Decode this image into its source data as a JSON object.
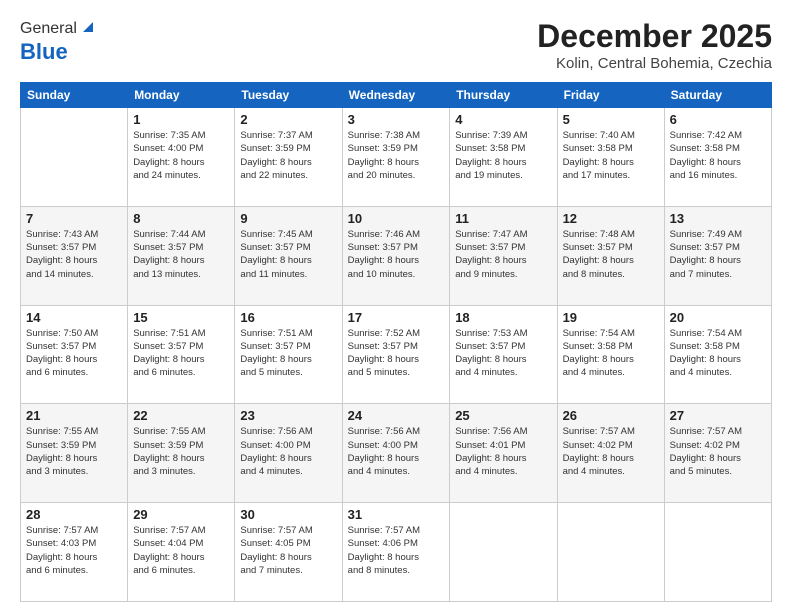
{
  "logo": {
    "general": "General",
    "blue": "Blue"
  },
  "header": {
    "month": "December 2025",
    "location": "Kolin, Central Bohemia, Czechia"
  },
  "weekdays": [
    "Sunday",
    "Monday",
    "Tuesday",
    "Wednesday",
    "Thursday",
    "Friday",
    "Saturday"
  ],
  "weeks": [
    [
      {
        "day": "",
        "info": ""
      },
      {
        "day": "1",
        "info": "Sunrise: 7:35 AM\nSunset: 4:00 PM\nDaylight: 8 hours\nand 24 minutes."
      },
      {
        "day": "2",
        "info": "Sunrise: 7:37 AM\nSunset: 3:59 PM\nDaylight: 8 hours\nand 22 minutes."
      },
      {
        "day": "3",
        "info": "Sunrise: 7:38 AM\nSunset: 3:59 PM\nDaylight: 8 hours\nand 20 minutes."
      },
      {
        "day": "4",
        "info": "Sunrise: 7:39 AM\nSunset: 3:58 PM\nDaylight: 8 hours\nand 19 minutes."
      },
      {
        "day": "5",
        "info": "Sunrise: 7:40 AM\nSunset: 3:58 PM\nDaylight: 8 hours\nand 17 minutes."
      },
      {
        "day": "6",
        "info": "Sunrise: 7:42 AM\nSunset: 3:58 PM\nDaylight: 8 hours\nand 16 minutes."
      }
    ],
    [
      {
        "day": "7",
        "info": "Sunrise: 7:43 AM\nSunset: 3:57 PM\nDaylight: 8 hours\nand 14 minutes."
      },
      {
        "day": "8",
        "info": "Sunrise: 7:44 AM\nSunset: 3:57 PM\nDaylight: 8 hours\nand 13 minutes."
      },
      {
        "day": "9",
        "info": "Sunrise: 7:45 AM\nSunset: 3:57 PM\nDaylight: 8 hours\nand 11 minutes."
      },
      {
        "day": "10",
        "info": "Sunrise: 7:46 AM\nSunset: 3:57 PM\nDaylight: 8 hours\nand 10 minutes."
      },
      {
        "day": "11",
        "info": "Sunrise: 7:47 AM\nSunset: 3:57 PM\nDaylight: 8 hours\nand 9 minutes."
      },
      {
        "day": "12",
        "info": "Sunrise: 7:48 AM\nSunset: 3:57 PM\nDaylight: 8 hours\nand 8 minutes."
      },
      {
        "day": "13",
        "info": "Sunrise: 7:49 AM\nSunset: 3:57 PM\nDaylight: 8 hours\nand 7 minutes."
      }
    ],
    [
      {
        "day": "14",
        "info": "Sunrise: 7:50 AM\nSunset: 3:57 PM\nDaylight: 8 hours\nand 6 minutes."
      },
      {
        "day": "15",
        "info": "Sunrise: 7:51 AM\nSunset: 3:57 PM\nDaylight: 8 hours\nand 6 minutes."
      },
      {
        "day": "16",
        "info": "Sunrise: 7:51 AM\nSunset: 3:57 PM\nDaylight: 8 hours\nand 5 minutes."
      },
      {
        "day": "17",
        "info": "Sunrise: 7:52 AM\nSunset: 3:57 PM\nDaylight: 8 hours\nand 5 minutes."
      },
      {
        "day": "18",
        "info": "Sunrise: 7:53 AM\nSunset: 3:57 PM\nDaylight: 8 hours\nand 4 minutes."
      },
      {
        "day": "19",
        "info": "Sunrise: 7:54 AM\nSunset: 3:58 PM\nDaylight: 8 hours\nand 4 minutes."
      },
      {
        "day": "20",
        "info": "Sunrise: 7:54 AM\nSunset: 3:58 PM\nDaylight: 8 hours\nand 4 minutes."
      }
    ],
    [
      {
        "day": "21",
        "info": "Sunrise: 7:55 AM\nSunset: 3:59 PM\nDaylight: 8 hours\nand 3 minutes."
      },
      {
        "day": "22",
        "info": "Sunrise: 7:55 AM\nSunset: 3:59 PM\nDaylight: 8 hours\nand 3 minutes."
      },
      {
        "day": "23",
        "info": "Sunrise: 7:56 AM\nSunset: 4:00 PM\nDaylight: 8 hours\nand 4 minutes."
      },
      {
        "day": "24",
        "info": "Sunrise: 7:56 AM\nSunset: 4:00 PM\nDaylight: 8 hours\nand 4 minutes."
      },
      {
        "day": "25",
        "info": "Sunrise: 7:56 AM\nSunset: 4:01 PM\nDaylight: 8 hours\nand 4 minutes."
      },
      {
        "day": "26",
        "info": "Sunrise: 7:57 AM\nSunset: 4:02 PM\nDaylight: 8 hours\nand 4 minutes."
      },
      {
        "day": "27",
        "info": "Sunrise: 7:57 AM\nSunset: 4:02 PM\nDaylight: 8 hours\nand 5 minutes."
      }
    ],
    [
      {
        "day": "28",
        "info": "Sunrise: 7:57 AM\nSunset: 4:03 PM\nDaylight: 8 hours\nand 6 minutes."
      },
      {
        "day": "29",
        "info": "Sunrise: 7:57 AM\nSunset: 4:04 PM\nDaylight: 8 hours\nand 6 minutes."
      },
      {
        "day": "30",
        "info": "Sunrise: 7:57 AM\nSunset: 4:05 PM\nDaylight: 8 hours\nand 7 minutes."
      },
      {
        "day": "31",
        "info": "Sunrise: 7:57 AM\nSunset: 4:06 PM\nDaylight: 8 hours\nand 8 minutes."
      },
      {
        "day": "",
        "info": ""
      },
      {
        "day": "",
        "info": ""
      },
      {
        "day": "",
        "info": ""
      }
    ]
  ]
}
